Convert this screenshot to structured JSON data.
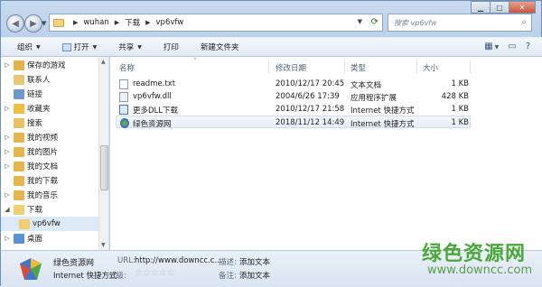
{
  "address": {
    "crumbs": [
      "wuhan",
      "下载",
      "vp6vfw"
    ]
  },
  "search": {
    "placeholder": "搜索 vp6vfw"
  },
  "toolbar": {
    "organize": "组织",
    "open": "打开",
    "share": "共享",
    "print": "打印",
    "new_folder": "新建文件夹"
  },
  "nav": {
    "items": [
      {
        "label": "保存的游戏",
        "icon": "saved-games-icon"
      },
      {
        "label": "联系人",
        "icon": "contacts-icon"
      },
      {
        "label": "链接",
        "icon": "links-icon"
      },
      {
        "label": "收藏夹",
        "icon": "favorites-icon"
      },
      {
        "label": "搜索",
        "icon": "search-folder-icon"
      },
      {
        "label": "我的视频",
        "icon": "videos-icon"
      },
      {
        "label": "我的图片",
        "icon": "pictures-icon"
      },
      {
        "label": "我的文档",
        "icon": "documents-icon"
      },
      {
        "label": "我的下载",
        "icon": "downloads-icon"
      },
      {
        "label": "我的音乐",
        "icon": "music-icon"
      },
      {
        "label": "下载",
        "icon": "download-folder-icon"
      },
      {
        "label": "vp6vfw",
        "icon": "folder-icon"
      },
      {
        "label": "桌面",
        "icon": "desktop-icon"
      }
    ]
  },
  "columns": {
    "name": "名称",
    "date": "修改日期",
    "type": "类型",
    "size": "大小"
  },
  "files": [
    {
      "name": "readme.txt",
      "date": "2010/12/17 20:45",
      "type": "文本文档",
      "size": "1 KB",
      "icon": "text-file-icon"
    },
    {
      "name": "vp6vfw.dll",
      "date": "2004/6/26 17:39",
      "type": "应用程序扩展",
      "size": "428 KB",
      "icon": "dll-file-icon"
    },
    {
      "name": "更多DLL下载",
      "date": "2010/12/17 21:58",
      "type": "Internet 快捷方式",
      "size": "1 KB",
      "icon": "internet-shortcut-icon"
    },
    {
      "name": "绿色资源网",
      "date": "2018/11/12 14:49",
      "type": "Internet 快捷方式",
      "size": "1 KB",
      "icon": "website-shortcut-icon"
    }
  ],
  "details": {
    "name": "绿色资源网",
    "type": "Internet 快捷方式",
    "url_label": "URL:",
    "url_value": "http://www.downcc.c...",
    "rating_label": "分级:",
    "desc_label": "描述:",
    "desc_value": "添加文本",
    "remark_label": "备注:",
    "remark_value": "添加文本"
  },
  "watermark": {
    "title": "绿色资源网",
    "url": "www.downcc.com"
  }
}
